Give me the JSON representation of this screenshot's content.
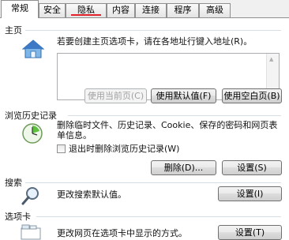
{
  "tabs": [
    {
      "label": "常规",
      "active": true
    },
    {
      "label": "安全"
    },
    {
      "label": "隐私",
      "highlighted": true
    },
    {
      "label": "内容"
    },
    {
      "label": "连接"
    },
    {
      "label": "程序"
    },
    {
      "label": "高级"
    }
  ],
  "home": {
    "title": "主页",
    "description": "若要创建主页选项卡，请在各地址行键入地址(R)。",
    "use_current": "使用当前页(C)",
    "use_default": "使用默认值(F)",
    "use_blank": "使用空白页(B)"
  },
  "history": {
    "title": "浏览历史记录",
    "description": "删除临时文件、历史记录、Cookie、保存的密码和网页表单信息。",
    "delete_on_exit": "退出时删除浏览历史记录(W)",
    "delete_btn": "删除(D)...",
    "settings_btn": "设置(S)"
  },
  "search": {
    "title": "搜索",
    "description": "更改搜索默认值。",
    "settings_btn": "设置(I)"
  },
  "tabsec": {
    "title": "选项卡",
    "description": "更改网页在选项卡中显示的方式。",
    "settings_btn": "设置(T)"
  },
  "colors": {
    "underline": "#e0222a",
    "line": "#d5dfe5"
  }
}
